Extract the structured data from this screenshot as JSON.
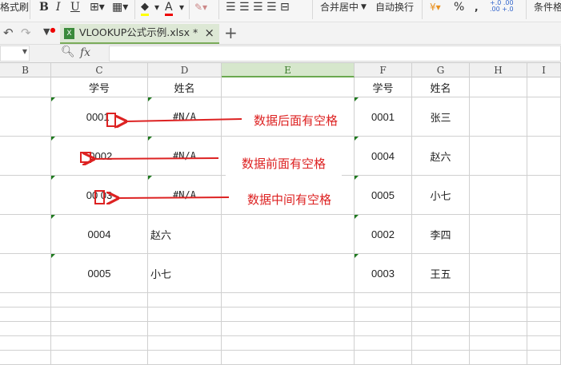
{
  "ribbon": {
    "format_painter": "格式刷",
    "bold": "B",
    "italic": "I",
    "underline": "U",
    "font_color": "A",
    "merge_center": "合并居中",
    "wrap_text": "自动换行",
    "percent": "%",
    "comma": ",",
    "cond_format": "条件格式",
    "fill_color": "#ffff00",
    "font_color_hex": "#e00000"
  },
  "tabs": {
    "file_name": "VLOOKUP公式示例.xlsx *",
    "close": "×",
    "add": "+"
  },
  "formula": {
    "fx": "fx",
    "name_box": "",
    "value": ""
  },
  "columns": [
    "B",
    "C",
    "D",
    "E",
    "F",
    "G",
    "H",
    "I"
  ],
  "sheet": {
    "header": {
      "c": "学号",
      "d": "姓名",
      "f": "学号",
      "g": "姓名"
    },
    "rows": [
      {
        "c": "0001 ",
        "d": "#N/A",
        "f": "0001",
        "g": "张三"
      },
      {
        "c": " 0002",
        "d": "#N/A",
        "f": "0004",
        "g": "赵六"
      },
      {
        "c": "00 03",
        "d": "#N/A",
        "f": "0005",
        "g": "小七"
      },
      {
        "c": "0004",
        "d": "赵六",
        "f": "0002",
        "g": "李四"
      },
      {
        "c": "0005",
        "d": "小七",
        "f": "0003",
        "g": "王五"
      }
    ]
  },
  "annotations": [
    "数据后面有空格",
    "数据前面有空格",
    "数据中间有空格"
  ],
  "colors": {
    "accent": "#6aa84f",
    "annotation": "#dd2222"
  }
}
